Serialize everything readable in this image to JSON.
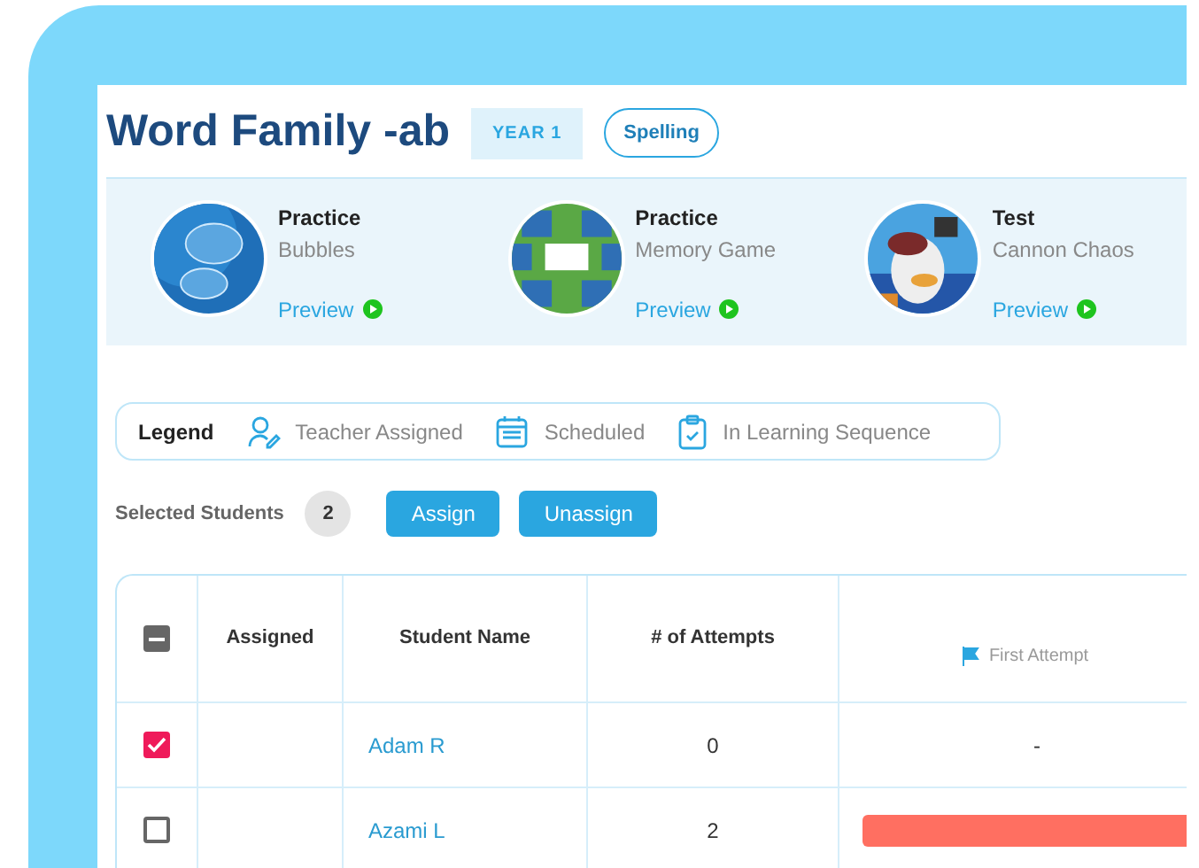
{
  "title": "Word Family -ab",
  "year_tag": "YEAR 1",
  "subject_tag": "Spelling",
  "activities": [
    {
      "type": "Practice",
      "name": "Bubbles",
      "link": "Preview"
    },
    {
      "type": "Practice",
      "name": "Memory Game",
      "link": "Preview"
    },
    {
      "type": "Test",
      "name": "Cannon Chaos",
      "link": "Preview"
    }
  ],
  "legend": {
    "label": "Legend",
    "items": [
      {
        "kind": "teacher",
        "label": "Teacher Assigned"
      },
      {
        "kind": "scheduled",
        "label": "Scheduled"
      },
      {
        "kind": "sequence",
        "label": "In Learning Sequence"
      }
    ]
  },
  "selected_students": {
    "label": "Selected Students",
    "count": "2"
  },
  "buttons": [
    "Assign",
    "Unassign"
  ],
  "table": {
    "select_all": {
      "indeterminate": true
    },
    "columns": [
      "Assigned",
      "Student Name",
      "# of Attempts",
      "First Attempt"
    ],
    "rows": [
      {
        "checked": true,
        "name": "Adam R",
        "attempts": "0",
        "first_attempt": {
          "kind": "text",
          "text": "-"
        }
      },
      {
        "checked": false,
        "name": "Azami L",
        "attempts": "2",
        "first_attempt": {
          "kind": "bar",
          "color": "#ff6f61"
        }
      }
    ]
  }
}
